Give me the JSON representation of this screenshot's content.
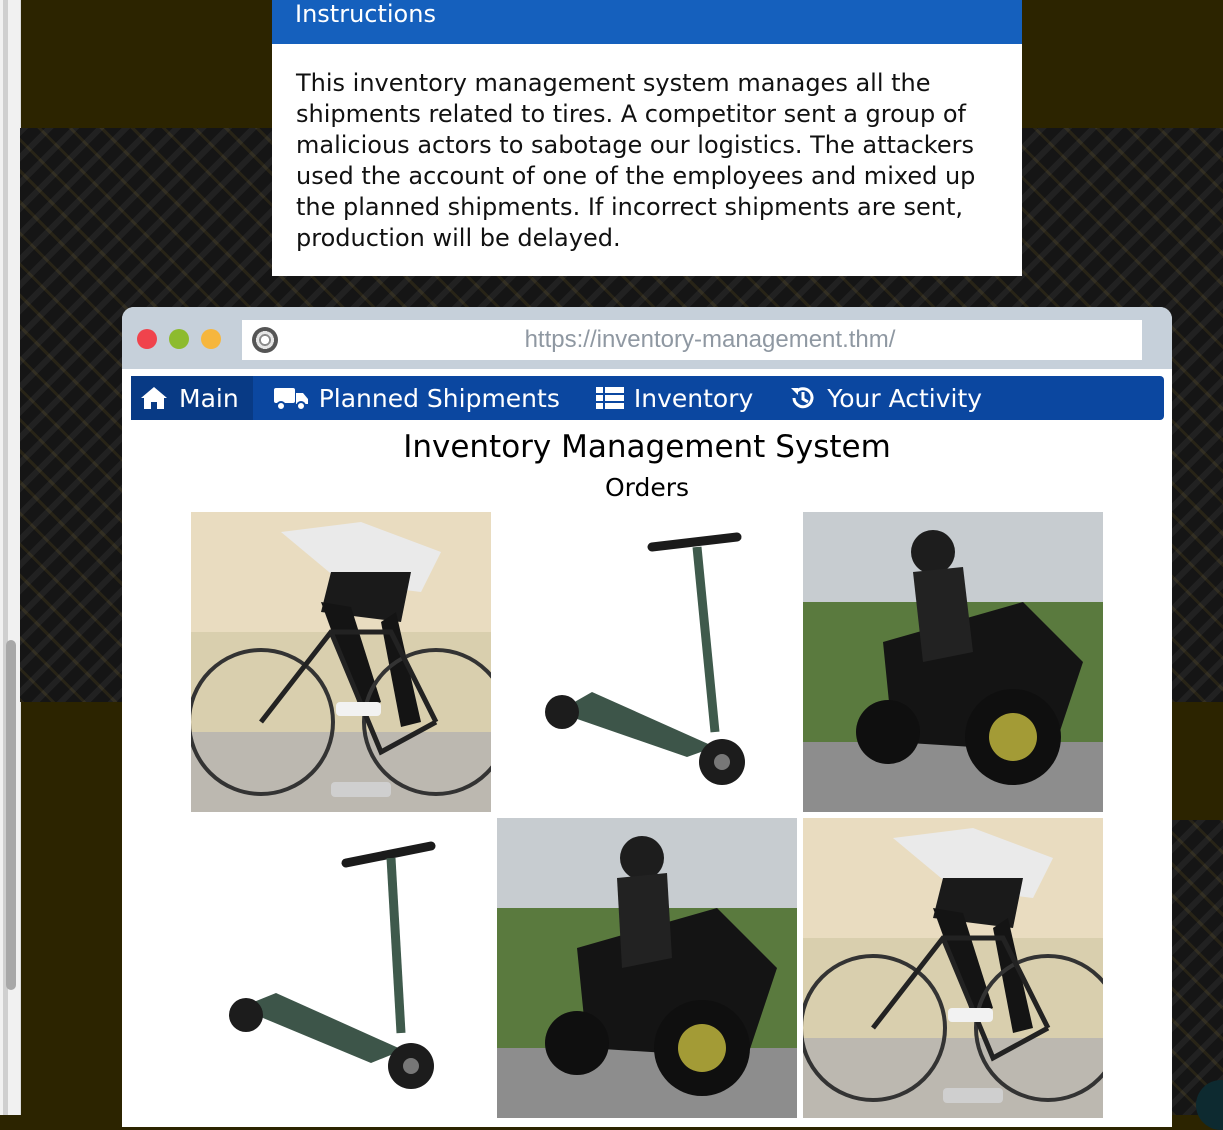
{
  "instructions": {
    "heading": "Instructions",
    "body": "This inventory management system manages all the shipments related to tires. A competitor sent a group of malicious actors to sabotage our logistics. The attackers used the account of one of the employees and mixed up the planned shipments. If incorrect shipments are sent, production will be delayed."
  },
  "browser": {
    "url": "https://inventory-management.thm/",
    "url_icon": "tire-icon"
  },
  "nav": {
    "items": [
      {
        "label": "Main",
        "icon": "home-icon",
        "active": true
      },
      {
        "label": "Planned Shipments",
        "icon": "truck-icon",
        "active": false
      },
      {
        "label": "Inventory",
        "icon": "list-icon",
        "active": false
      },
      {
        "label": "Your Activity",
        "icon": "history-icon",
        "active": false
      }
    ]
  },
  "page": {
    "title": "Inventory Management System",
    "subtitle": "Orders"
  },
  "orders": [
    {
      "product": "bicycle"
    },
    {
      "product": "scooter"
    },
    {
      "product": "motorcycle"
    },
    {
      "product": "scooter"
    },
    {
      "product": "motorcycle"
    },
    {
      "product": "bicycle"
    }
  ],
  "colors": {
    "instructions_header": "#1560bd",
    "navbar": "#0b47a0",
    "navbar_active": "#083a85",
    "page_background": "#2c2400"
  }
}
